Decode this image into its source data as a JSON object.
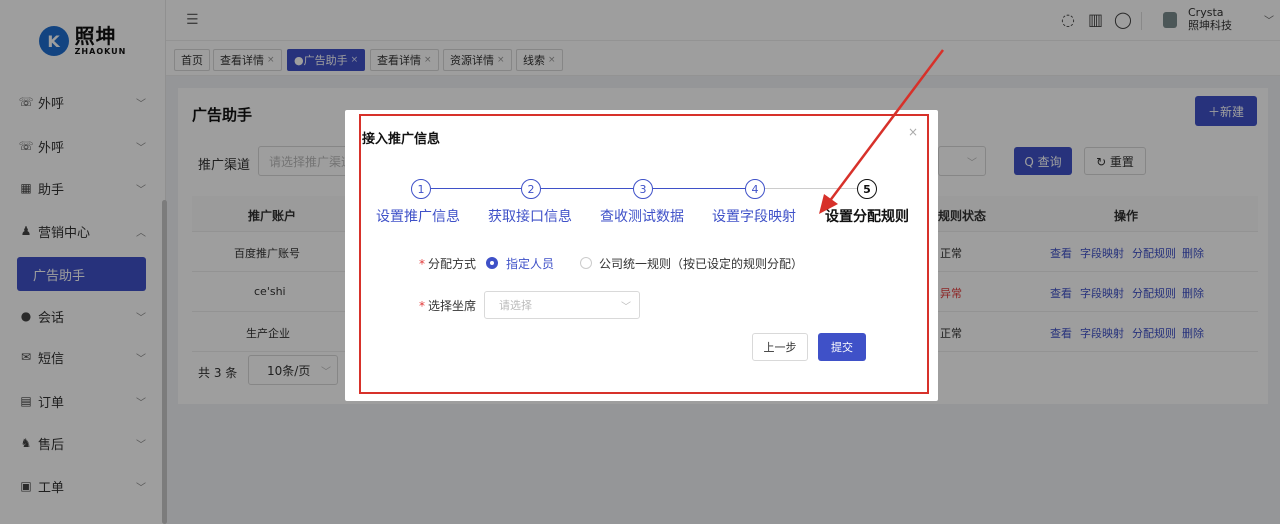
{
  "brand": {
    "cn": "照坤",
    "en": "ZHAOKUN",
    "mark": "K"
  },
  "user": {
    "name": "Crysta",
    "company": "照坤科技"
  },
  "sidebar": {
    "items": [
      {
        "label": "外呼",
        "icon": "phone-icon",
        "chev": "﹀"
      },
      {
        "label": "外呼",
        "icon": "phone-icon",
        "chev": "﹀"
      },
      {
        "label": "助手",
        "icon": "assistant-icon",
        "chev": "﹀"
      },
      {
        "label": "营销中心",
        "icon": "people-icon",
        "chev": "︿"
      },
      {
        "label": "会话",
        "icon": "chat-icon",
        "chev": "﹀"
      },
      {
        "label": "短信",
        "icon": "mail-icon",
        "chev": "﹀"
      },
      {
        "label": "订单",
        "icon": "order-icon",
        "chev": "﹀"
      },
      {
        "label": "售后",
        "icon": "service-icon",
        "chev": "﹀"
      },
      {
        "label": "工单",
        "icon": "ticket-icon",
        "chev": "﹀"
      }
    ],
    "active_sub": "广告助手"
  },
  "tabs": [
    {
      "label": "首页",
      "closable": false
    },
    {
      "label": "查看详情",
      "closable": true
    },
    {
      "label": "●广告助手",
      "closable": true,
      "active": true
    },
    {
      "label": "查看详情",
      "closable": true
    },
    {
      "label": "资源详情",
      "closable": true
    },
    {
      "label": "线索",
      "closable": true
    }
  ],
  "page": {
    "title": "广告助手",
    "new_button": "＋新建",
    "filter_label": "推广渠道",
    "filter_placeholder": "请选择推广渠道",
    "query_button": "Q 查询",
    "reset_button": "↻ 重置",
    "columns": {
      "account": "推广账户",
      "status": "规则状态",
      "ops": "操作"
    },
    "rows": [
      {
        "account": "百度推广账号",
        "status": "正常",
        "status_type": "ok"
      },
      {
        "account": "ce'shi",
        "status": "异常",
        "status_type": "error"
      },
      {
        "account": "生产企业",
        "status": "正常",
        "status_type": "ok"
      }
    ],
    "operations": [
      "查看",
      "字段映射",
      "分配规则",
      "删除"
    ],
    "total": "共 3 条",
    "page_size": "10条/页"
  },
  "modal": {
    "title": "接入推广信息",
    "close": "×",
    "steps": [
      {
        "num": "1",
        "label": "设置推广信息"
      },
      {
        "num": "2",
        "label": "获取接口信息"
      },
      {
        "num": "3",
        "label": "查收测试数据"
      },
      {
        "num": "4",
        "label": "设置字段映射"
      },
      {
        "num": "5",
        "label": "设置分配规则"
      }
    ],
    "current_step": 5,
    "assign_label": "分配方式",
    "assign_options": [
      {
        "label": "指定人员",
        "selected": true
      },
      {
        "label": "公司统一规则（按已设定的规则分配）",
        "selected": false
      }
    ],
    "seat_label": "选择坐席",
    "seat_placeholder": "请选择",
    "prev_button": "上一步",
    "submit_button": "提交"
  },
  "colors": {
    "primary": "#3f51c8",
    "error": "#e23b3b",
    "annotation": "#d7312a"
  }
}
